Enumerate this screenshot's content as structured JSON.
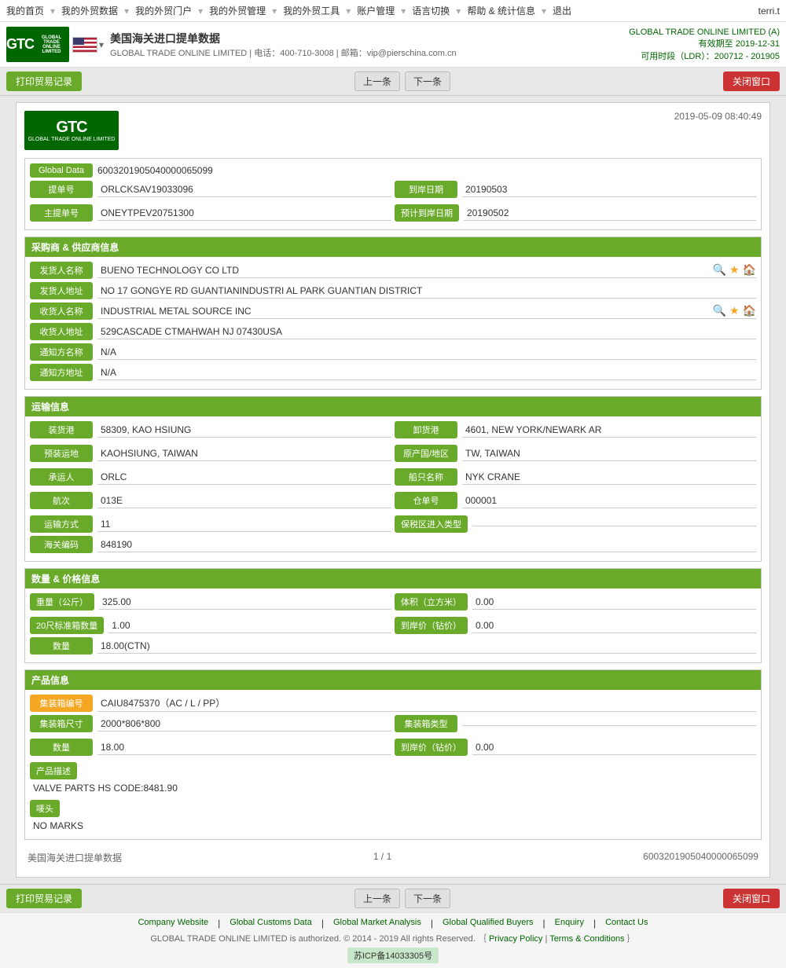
{
  "topnav": {
    "items": [
      "我的首页",
      "我的外贸数据",
      "我的外贸门户",
      "我的外贸管理",
      "我的外贸工具",
      "账户管理",
      "语言切换",
      "帮助 & 统计信息",
      "退出"
    ],
    "user": "terri.t"
  },
  "header": {
    "logo_text": "GTC",
    "logo_sub": "GLOBAL TRADE ONLINE LIMITED",
    "title": "美国海关进口提单数据",
    "subtitle_company": "GLOBAL TRADE ONLINE LIMITED",
    "subtitle_tel": "电话：400-710-3008",
    "subtitle_email": "邮箱：vip@pierschina.com.cn",
    "right_title": "GLOBAL TRADE ONLINE LIMITED (A)",
    "right_date": "有效期至 2019-12-31",
    "right_ldr": "可用时段（LDR）：200712 - 201905"
  },
  "toolbar": {
    "print_label": "打印贸易记录",
    "prev_label": "上一条",
    "next_label": "下一条",
    "close_label": "关闭窗口"
  },
  "document": {
    "timestamp": "2019-05-09 08:40:49",
    "global_data_label": "Global Data",
    "global_data_value": "6003201905040000065099",
    "bill_no_label": "提单号",
    "bill_no_value": "ORLCKSAV19033096",
    "arrival_date_label": "到岸日期",
    "arrival_date_value": "20190503",
    "main_bill_label": "主提单号",
    "main_bill_value": "ONEYTPEV20751300",
    "est_arrival_label": "预计到岸日期",
    "est_arrival_value": "20190502"
  },
  "buyer_seller": {
    "section_title": "采购商 & 供应商信息",
    "shipper_name_label": "发货人名称",
    "shipper_name_value": "BUENO TECHNOLOGY CO LTD",
    "shipper_addr_label": "发货人地址",
    "shipper_addr_value": "NO 17 GONGYE RD GUANTIANINDUSTRI AL PARK GUANTIAN DISTRICT",
    "consignee_name_label": "收货人名称",
    "consignee_name_value": "INDUSTRIAL METAL SOURCE INC",
    "consignee_addr_label": "收货人地址",
    "consignee_addr_value": "529CASCADE CTMAHWAH NJ 07430USA",
    "notify_name_label": "通知方名称",
    "notify_name_value": "N/A",
    "notify_addr_label": "通知方地址",
    "notify_addr_value": "N/A"
  },
  "transport": {
    "section_title": "运输信息",
    "loading_port_label": "装货港",
    "loading_port_value": "58309, KAO HSIUNG",
    "unloading_port_label": "卸货港",
    "unloading_port_value": "4601, NEW YORK/NEWARK AR",
    "pre_load_label": "预装运地",
    "pre_load_value": "KAOHSIUNG, TAIWAN",
    "origin_country_label": "原产国/地区",
    "origin_country_value": "TW, TAIWAN",
    "carrier_label": "承运人",
    "carrier_value": "ORLC",
    "vessel_label": "船只名称",
    "vessel_value": "NYK CRANE",
    "voyage_label": "航次",
    "voyage_value": "013E",
    "warehouse_label": "仓单号",
    "warehouse_value": "000001",
    "transport_mode_label": "运输方式",
    "transport_mode_value": "11",
    "ftz_type_label": "保税区进入类型",
    "ftz_type_value": "",
    "customs_code_label": "海关编码",
    "customs_code_value": "848190"
  },
  "quantity_price": {
    "section_title": "数量 & 价格信息",
    "weight_label": "重量（公斤）",
    "weight_value": "325.00",
    "volume_label": "体积（立方米）",
    "volume_value": "0.00",
    "container_20_label": "20尺标准箱数量",
    "container_20_value": "1.00",
    "arrival_price_label": "到岸价（钻价）",
    "arrival_price_value": "0.00",
    "qty_label": "数量",
    "qty_value": "18.00(CTN)"
  },
  "product": {
    "section_title": "产品信息",
    "container_no_label": "集装箱编号",
    "container_no_value": "CAIU8475370（AC / L / PP）",
    "container_size_label": "集装箱尺寸",
    "container_size_value": "2000*806*800",
    "container_type_label": "集装箱类型",
    "container_type_value": "",
    "qty_label": "数量",
    "qty_value": "18.00",
    "arrival_price_label": "到岸价（钻价）",
    "arrival_price_value": "0.00",
    "product_desc_label": "产品描述",
    "product_desc_value": "VALVE PARTS HS CODE:8481.90",
    "marks_label": "唛头",
    "marks_value": "NO MARKS"
  },
  "doc_footer": {
    "left": "美国海关进口提单数据",
    "center": "1 / 1",
    "right": "6003201905040000065099"
  },
  "footer": {
    "links": [
      "Company Website",
      "Global Customs Data",
      "Global Market Analysis",
      "Global Qualified Buyers",
      "Enquiry",
      "Contact Us"
    ],
    "copy": "GLOBAL TRADE ONLINE LIMITED is authorized. © 2014 - 2019 All rights Reserved.  ｛",
    "privacy": "Privacy Policy",
    "pipe": " | ",
    "terms": "Terms & Conditions",
    "close_brace": " ｝",
    "icp": "苏ICP备14033305号"
  }
}
